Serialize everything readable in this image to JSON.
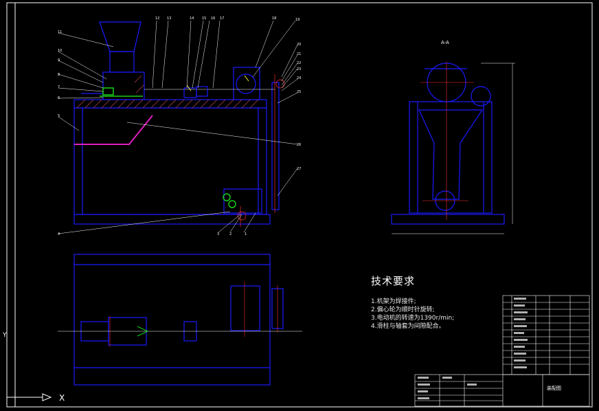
{
  "drawing": {
    "section_label": "A-A",
    "tech_requirements": {
      "title": "技术要求",
      "items": [
        "1.机架为焊接件;",
        "2.偏心轮为顺时针旋转;",
        "3.电动机的转速为1390r/min;",
        "4.滑柱与轴套为间隙配合。"
      ]
    },
    "part_numbers_top": [
      "11",
      "10",
      "9",
      "8",
      "7",
      "6",
      "5",
      "4",
      "3",
      "2",
      "1",
      "12",
      "13",
      "14",
      "15",
      "16",
      "17",
      "18",
      "19",
      "20",
      "21",
      "22",
      "23",
      "24",
      "25",
      "26",
      "27"
    ],
    "title_block_name": "装配图",
    "axis_labels": {
      "x": "X",
      "y": "Y"
    },
    "colors": {
      "background": "#000000",
      "frame": "#ffffff",
      "geometry": "#1a1aff",
      "center_lines": "#ff3030",
      "green": "#18d018",
      "magenta": "#e020c0",
      "yellow": "#f0f020",
      "hatch": "#b04040"
    }
  }
}
